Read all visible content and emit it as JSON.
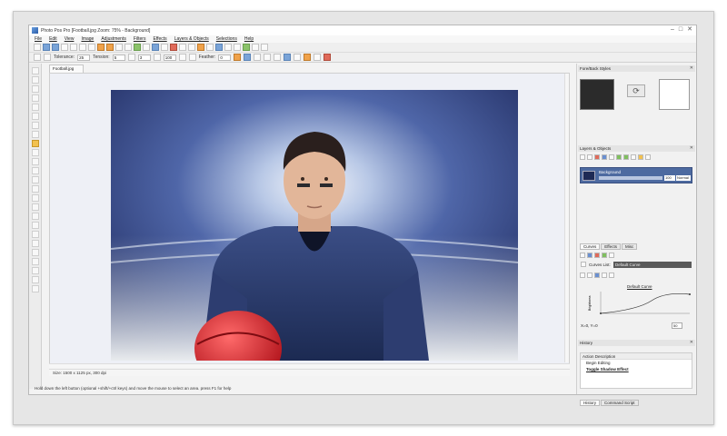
{
  "app": {
    "title": "Photo Pos Pro [Football.jpg Zoom: 75% - Background]",
    "window_controls": [
      "–",
      "□",
      "✕"
    ]
  },
  "menu": [
    "File",
    "Edit",
    "View",
    "Image",
    "Adjustments",
    "Filters",
    "Effects",
    "Layers & Objects",
    "Selections",
    "Help"
  ],
  "options_bar": {
    "tolerance_label": "Tolerance:",
    "tolerance_value": "25",
    "tension_label": "Tension:",
    "tension_value": "5",
    "val3": "3",
    "val4": "100",
    "feather_label": "Feather:",
    "feather_value": "0"
  },
  "document": {
    "tab": "Football.jpg",
    "size_status": "Size: 1500 x 1125 px, 300 dpi"
  },
  "status_hint": "Hold down the left button (optional +shift/+ctrl keys) and move the mouse to select an area. press F1 for help",
  "panels": {
    "fore_back": {
      "title": "Fore/Back Styles",
      "fore_color": "#2b2b2b",
      "back_color": "#ffffff"
    },
    "layers": {
      "title": "Layers & Objects",
      "layer_name": "Background",
      "opacity": "100",
      "mode": "Normal"
    },
    "adjust_tabs": [
      "Curves",
      "Effects",
      "Misc"
    ],
    "curves": {
      "list_label": "Curves List:",
      "selected": "Default Curve",
      "graph_title": "Default Curve",
      "y_axis_label": "Brightness",
      "x_axis_label": "Brightness",
      "x_ticks": [
        "0",
        "20",
        "40",
        "60",
        "80",
        "100"
      ],
      "y_ticks": [
        "100",
        "80",
        "60",
        "40",
        "20",
        "0"
      ],
      "io_label": "X=0, Y=0",
      "io_value": "50"
    },
    "history": {
      "title": "History",
      "header": "Action Description",
      "items": [
        "Begin Editing",
        "Toggle Shadow Effect"
      ]
    },
    "bottom_tabs": [
      "History",
      "Command Script"
    ]
  }
}
